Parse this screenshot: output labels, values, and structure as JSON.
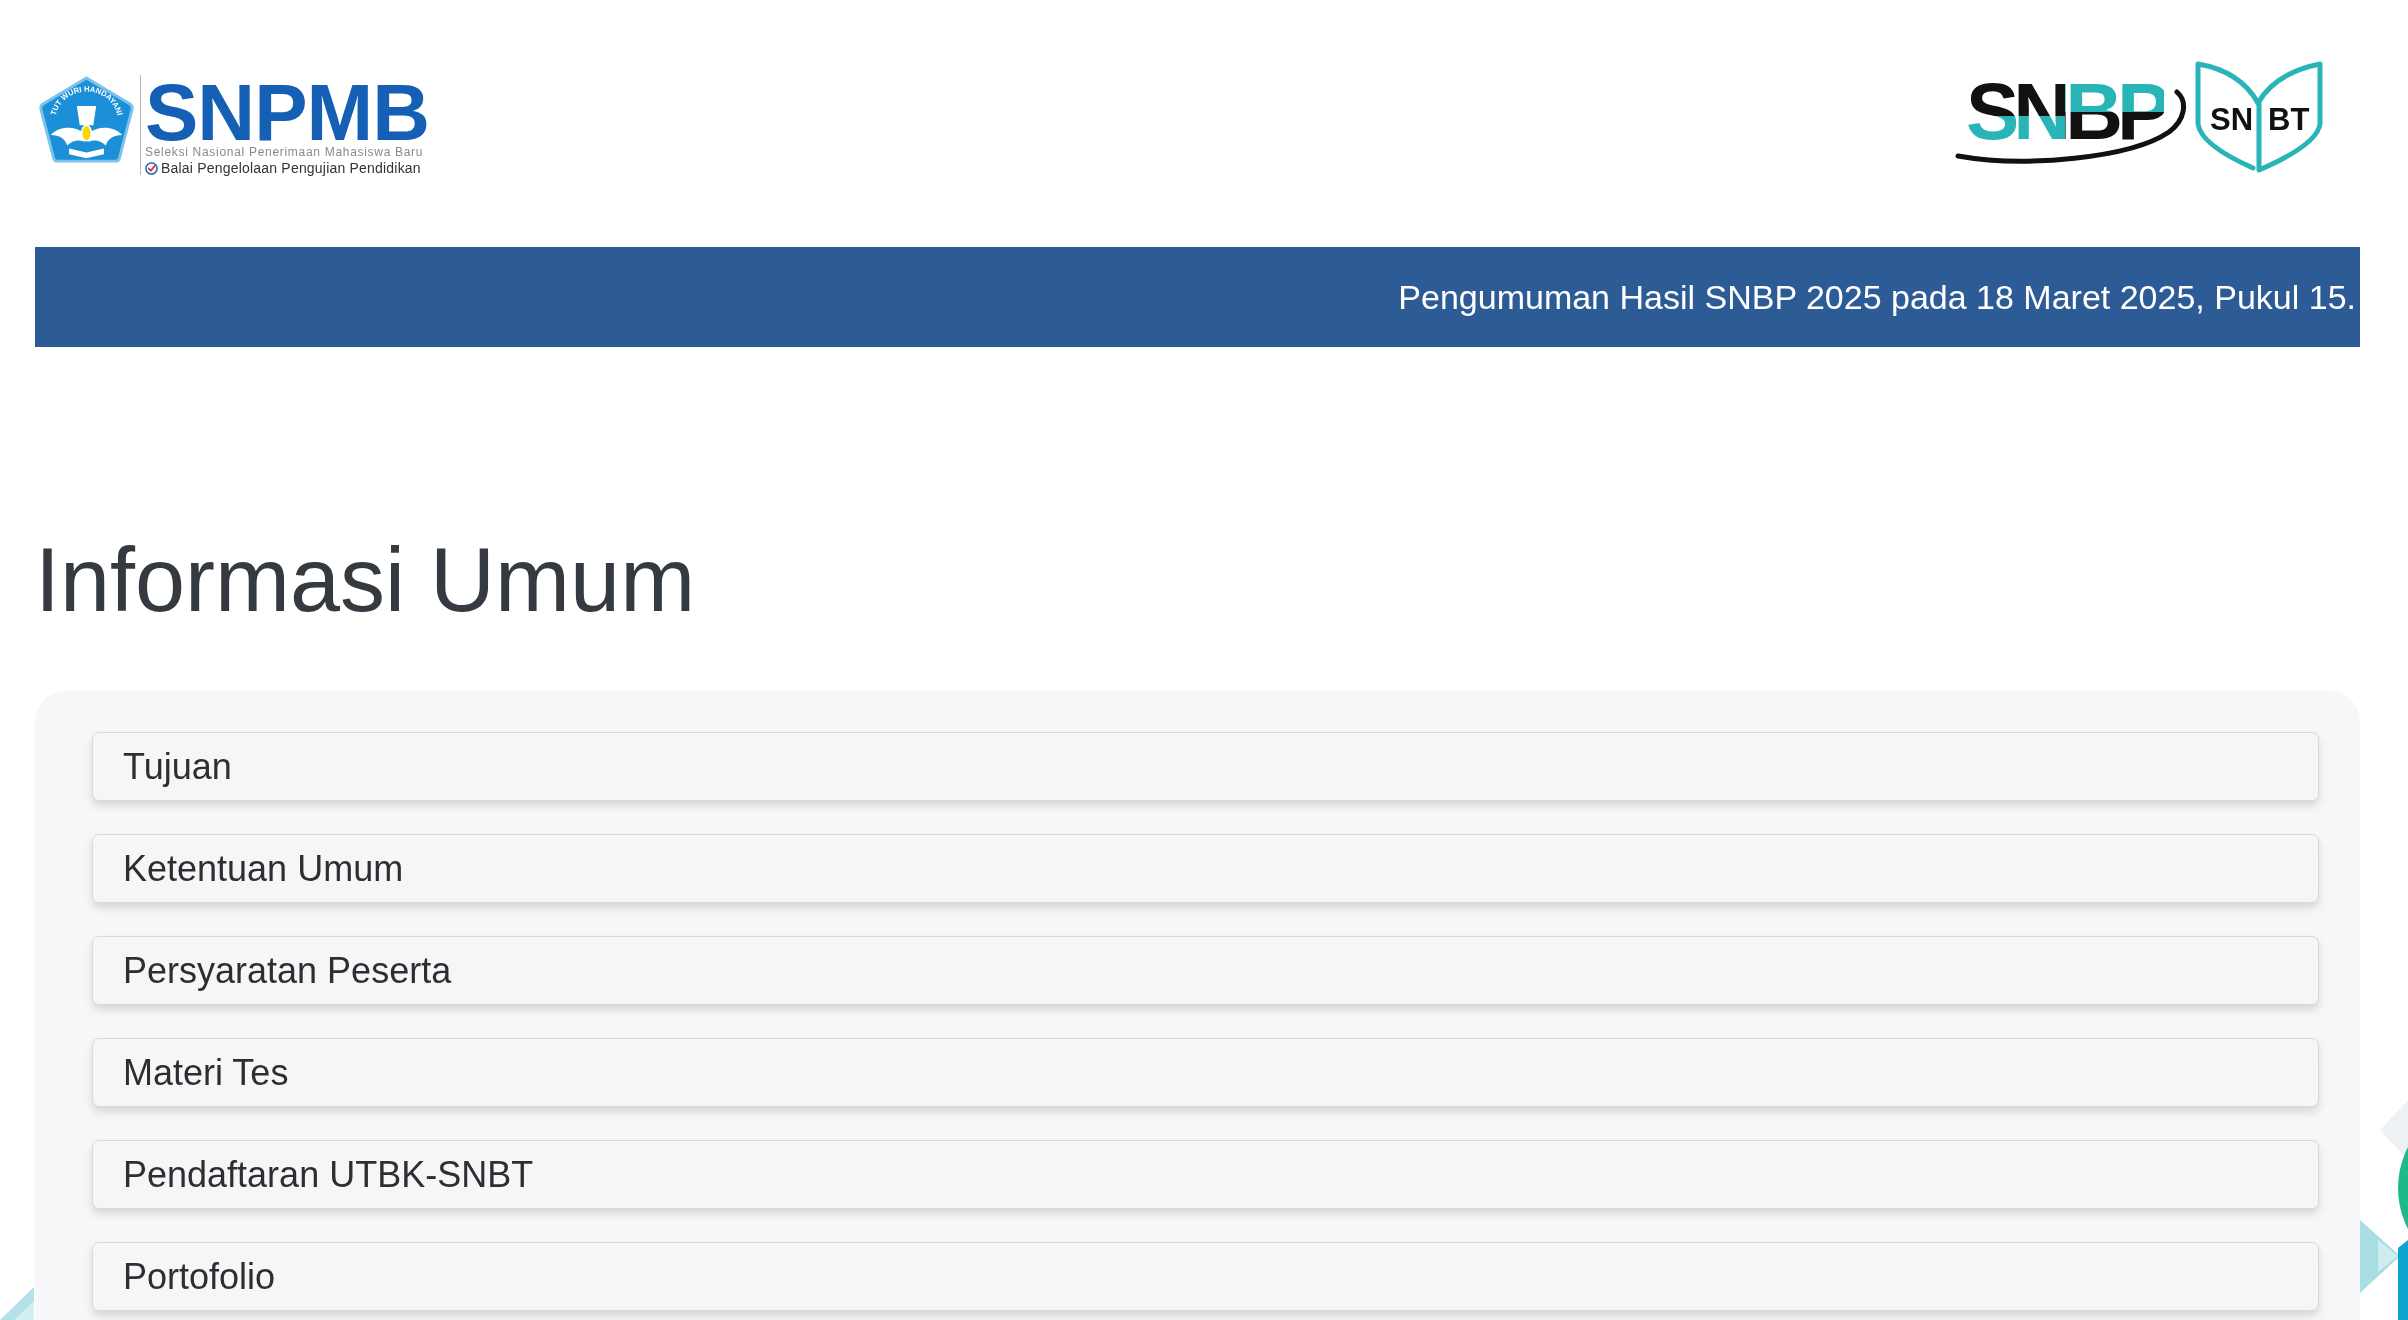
{
  "header": {
    "logo": {
      "emblem_motto": "TUT WURI HANDAYANI",
      "wordmark": "SNPMB",
      "tagline": "Seleksi Nasional Penerimaan Mahasiswa Baru",
      "subtitle": "Balai Pengelolaan Pengujian Pendidikan"
    },
    "partner_logos": [
      {
        "kind": "snbp",
        "texts": [
          "SNBP"
        ]
      },
      {
        "kind": "snbt",
        "texts": [
          "SN",
          "BT"
        ]
      }
    ]
  },
  "announcement": {
    "text": "Pengumuman Hasil SNBP 2025 pada 18 Maret 2025, Pukul 15."
  },
  "section": {
    "title": "Informasi Umum",
    "items": [
      {
        "label": "Tujuan"
      },
      {
        "label": "Ketentuan Umum"
      },
      {
        "label": "Persyaratan Peserta"
      },
      {
        "label": "Materi Tes"
      },
      {
        "label": "Pendaftaran UTBK-SNBT"
      },
      {
        "label": "Portofolio"
      }
    ]
  }
}
